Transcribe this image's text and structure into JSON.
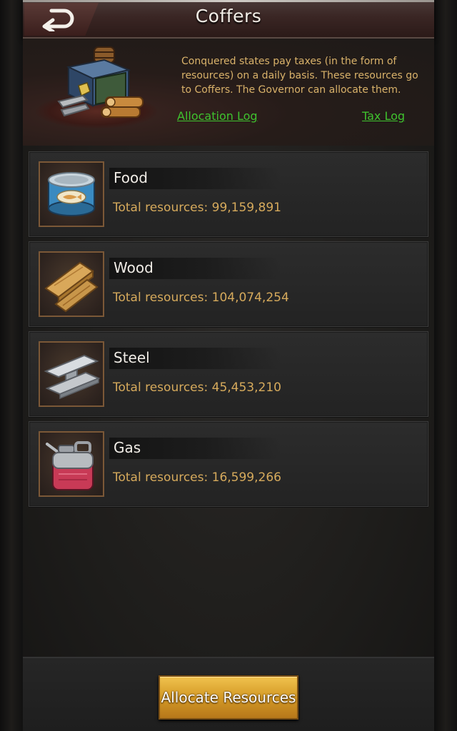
{
  "header": {
    "title": "Coffers",
    "back_icon": "back-arrow-icon"
  },
  "info": {
    "description": "Conquered states pay taxes (in the form of resources) on a daily basis. These resources go to Coffers. The Governor can allocate them.",
    "allocation_log_label": "Allocation Log",
    "tax_log_label": "Tax Log",
    "illustration_icon": "resource-crate-icon"
  },
  "resources": [
    {
      "name": "Food",
      "total": "Total resources: 99,159,891",
      "icon": "food-can-icon"
    },
    {
      "name": "Wood",
      "total": "Total resources: 104,074,254",
      "icon": "wood-planks-icon"
    },
    {
      "name": "Steel",
      "total": "Total resources: 45,453,210",
      "icon": "steel-beam-icon"
    },
    {
      "name": "Gas",
      "total": "Total resources: 16,599,266",
      "icon": "gas-can-icon"
    }
  ],
  "footer": {
    "allocate_label": "Allocate Resources"
  },
  "colors": {
    "link": "#3fc22e",
    "gold_text": "#d6aa5c",
    "button_gold": "#d49a26",
    "header_red": "#3a2624"
  }
}
